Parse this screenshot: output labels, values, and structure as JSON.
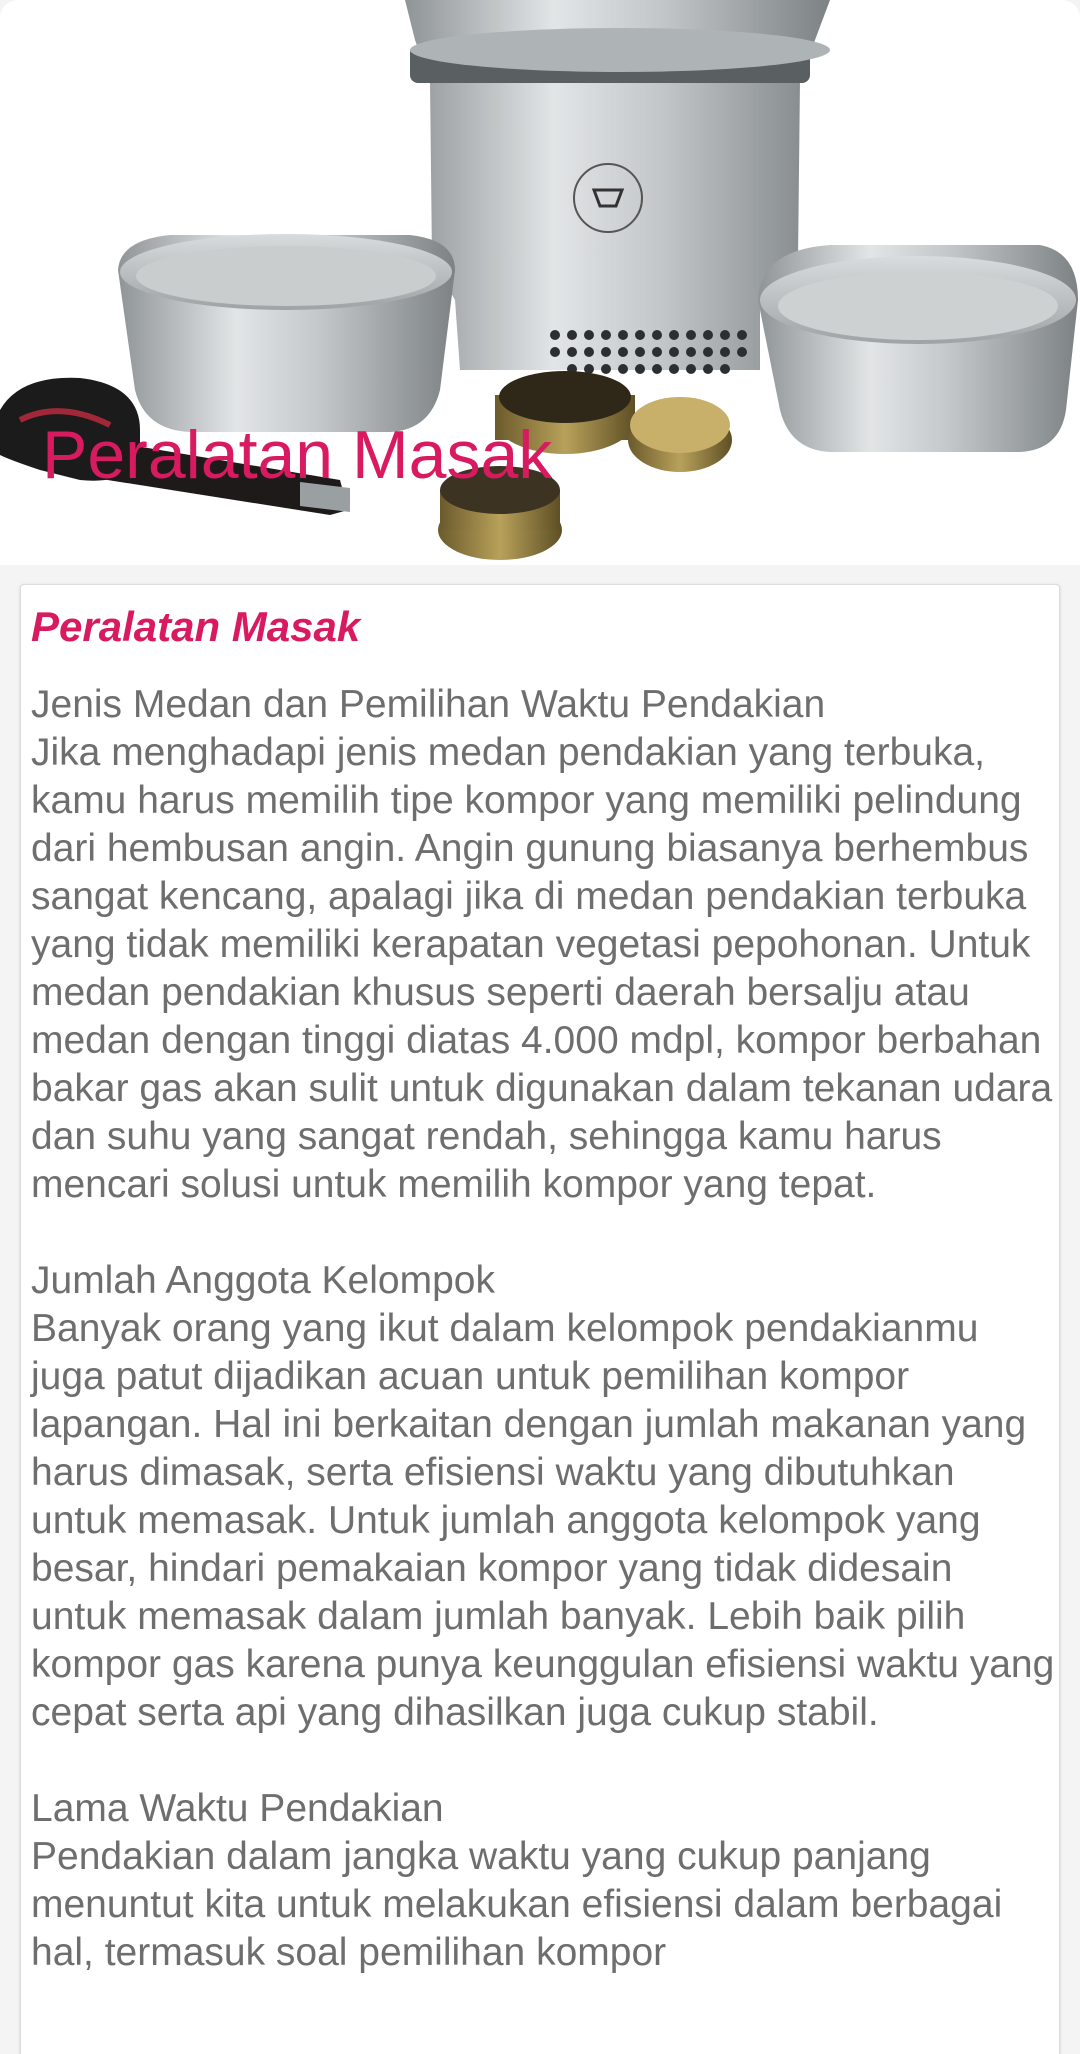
{
  "header": {
    "title": "Peralatan Masak",
    "image_icon": "cooking-set-image"
  },
  "card": {
    "title": "Peralatan Masak",
    "sections": [
      {
        "heading": "Jenis Medan dan Pemilihan Waktu Pendakian",
        "text": "Jika menghadapi jenis medan pendakian yang terbuka, kamu harus memilih tipe kompor yang memiliki pelindung dari hembusan angin. Angin gunung biasanya berhembus sangat kencang, apalagi jika di medan pendakian terbuka yang tidak memiliki kerapatan vegetasi pepohonan. Untuk medan pendakian khusus seperti daerah bersalju atau medan dengan tinggi diatas 4.000 mdpl, kompor berbahan bakar gas akan sulit untuk digunakan dalam tekanan udara dan suhu yang sangat rendah, sehingga kamu harus mencari solusi untuk memilih kompor yang tepat."
      },
      {
        "heading": "Jumlah Anggota Kelompok",
        "text": "Banyak orang yang ikut dalam kelompok pendakianmu juga patut dijadikan acuan untuk pemilihan kompor lapangan. Hal ini berkaitan dengan jumlah makanan yang harus dimasak, serta efisiensi waktu yang dibutuhkan untuk memasak. Untuk jumlah anggota kelompok yang besar, hindari pemakaian kompor yang tidak didesain untuk memasak dalam jumlah banyak. Lebih baik pilih kompor gas karena punya keunggulan efisiensi waktu yang cepat serta api yang dihasilkan juga cukup stabil."
      },
      {
        "heading": "Lama Waktu Pendakian",
        "text": "Pendakian dalam jangka waktu yang cukup panjang menuntut kita untuk melakukan efisiensi dalam berbagai hal, termasuk soal pemilihan kompor"
      }
    ]
  },
  "colors": {
    "accent": "#d81b60",
    "body_text": "#6e6e6e",
    "background": "#f4f4f4",
    "card": "#ffffff"
  }
}
